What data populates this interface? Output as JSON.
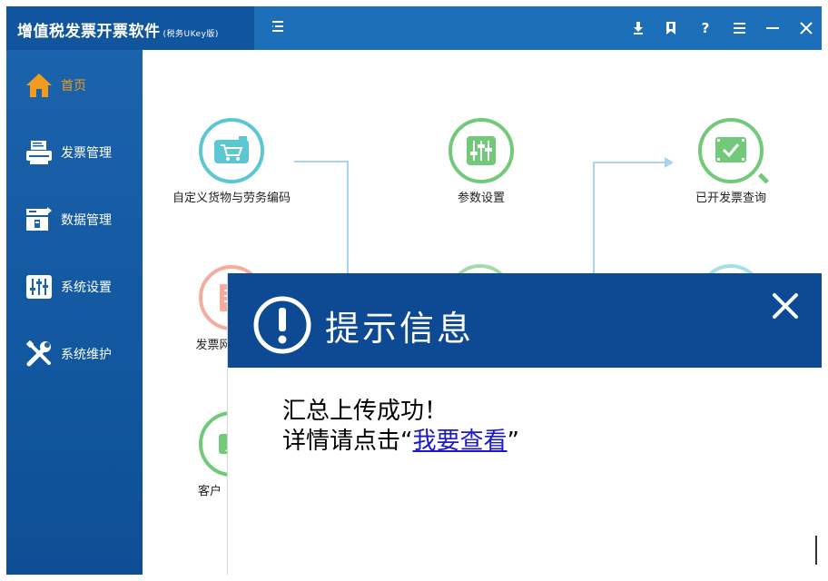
{
  "app": {
    "title": "增值税发票开票软件",
    "subtitle": "(税务UKey版)",
    "collapse_icon": "menu-collapse-icon",
    "colors": {
      "titlebar": "#1e6fba",
      "title_block": "#11559e",
      "sidebar": "#1b63ab",
      "active": "#f29b1d",
      "dialog_header": "#0d4a93",
      "link": "#1b19c8"
    },
    "window_buttons": [
      {
        "name": "download-icon"
      },
      {
        "name": "bookmark-icon"
      },
      {
        "name": "help-icon",
        "label": "?"
      },
      {
        "name": "menu-icon"
      },
      {
        "name": "minimize-icon"
      },
      {
        "name": "close-icon"
      }
    ]
  },
  "sidebar": {
    "items": [
      {
        "label": "首页",
        "icon": "home-icon",
        "active": true
      },
      {
        "label": "发票管理",
        "icon": "printer-icon"
      },
      {
        "label": "数据管理",
        "icon": "data-icon"
      },
      {
        "label": "系统设置",
        "icon": "sliders-icon"
      },
      {
        "label": "系统维护",
        "icon": "tools-icon"
      }
    ]
  },
  "main": {
    "tiles": [
      {
        "label": "自定义货物与劳务编码",
        "icon": "cart-icon"
      },
      {
        "label": "参数设置",
        "icon": "sliders-icon"
      },
      {
        "label": "已开发票查询",
        "icon": "search-check-icon"
      },
      {
        "label": "发票网",
        "icon": "invoice-icon"
      },
      {
        "label": "客户",
        "icon": "customer-icon"
      }
    ]
  },
  "dialog": {
    "title": "提示信息",
    "icon": "exclamation-icon",
    "close_icon": "close-icon",
    "line1": "汇总上传成功！",
    "line2_prefix": "详情请点击",
    "quote_open": "“",
    "link": "我要查看",
    "quote_close": "”"
  }
}
